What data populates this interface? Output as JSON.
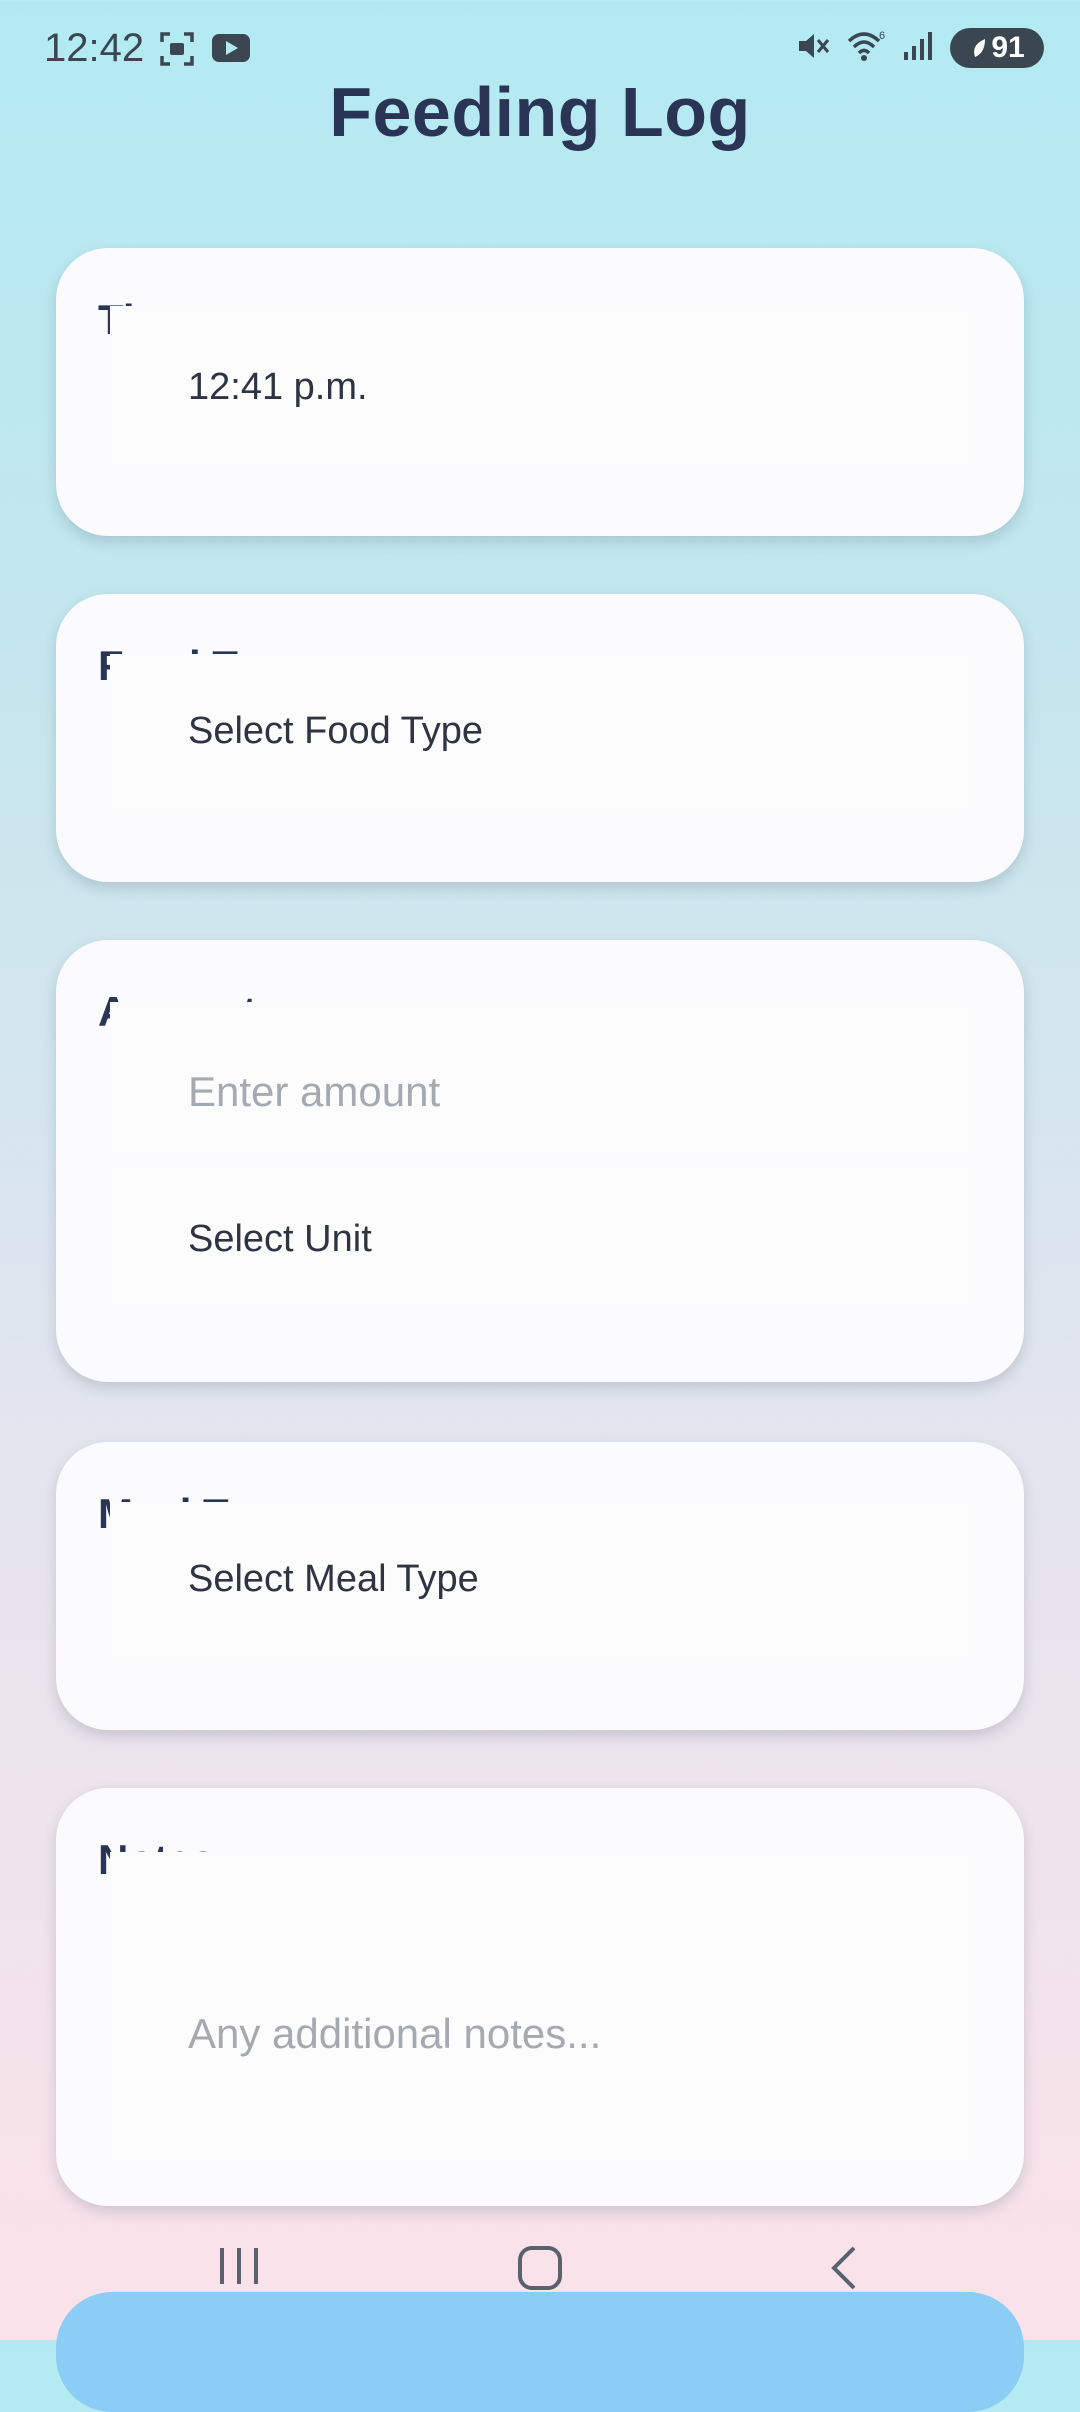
{
  "status_bar": {
    "time": "12:42",
    "battery": "91"
  },
  "header": {
    "title": "Feeding Log"
  },
  "time_card": {
    "label": "Time",
    "value": "12:41 p.m."
  },
  "food_type_card": {
    "label": "Food Type",
    "value": "Select Food Type"
  },
  "amount_card": {
    "label": "Amount",
    "amount_placeholder": "Enter amount",
    "unit_value": "Select Unit"
  },
  "meal_type_card": {
    "label": "Meal Type",
    "value": "Select Meal Type"
  },
  "notes_card": {
    "label": "Notes",
    "placeholder": "Any additional notes..."
  },
  "icons": [
    "screenshot-icon",
    "youtube-icon",
    "mute-icon",
    "wifi-icon",
    "signal-icon",
    "battery-icon",
    "recent-apps-icon",
    "home-icon",
    "back-icon"
  ],
  "colors": {
    "title": "#2a3556",
    "card_bg": "#fbfbfd",
    "submit_button": "#8ccdf5"
  }
}
